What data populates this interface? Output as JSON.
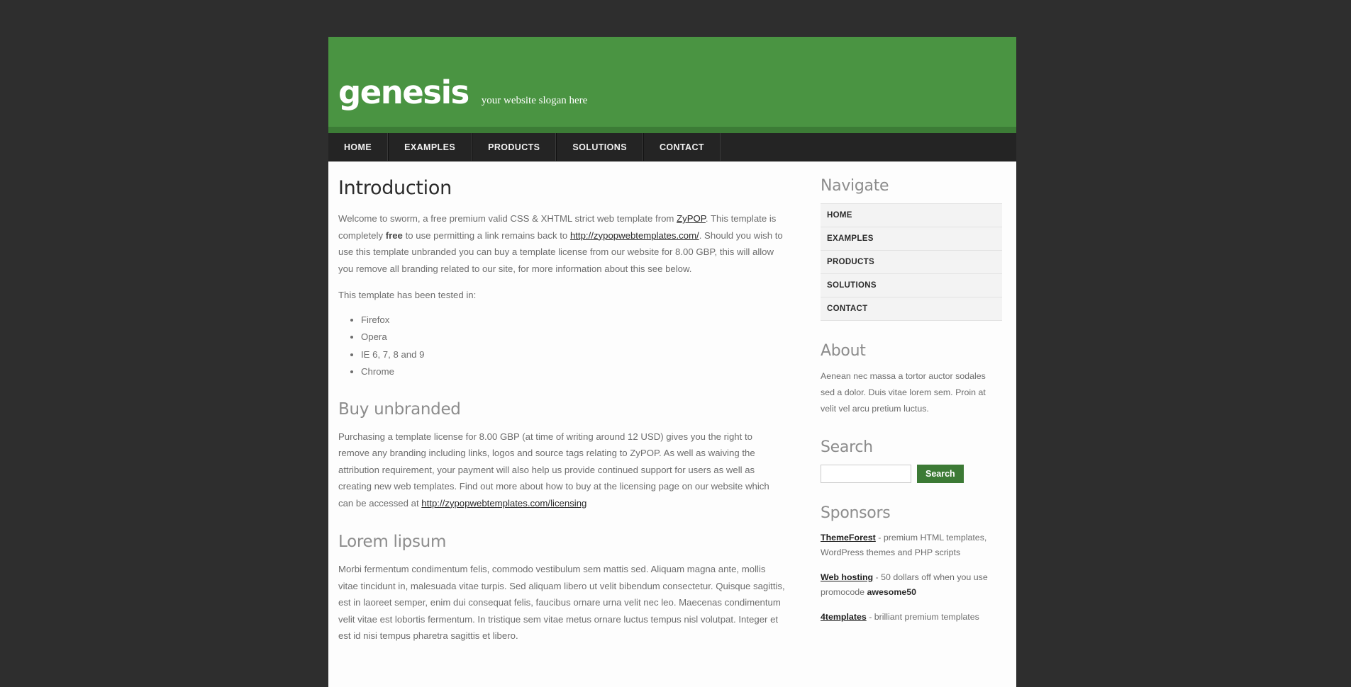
{
  "header": {
    "logo": "genesis",
    "slogan": "your website slogan here",
    "green": "#4a9442",
    "dark_green": "#3c7c36"
  },
  "main_nav": {
    "items": [
      {
        "label": "HOME"
      },
      {
        "label": "EXAMPLES"
      },
      {
        "label": "PRODUCTS"
      },
      {
        "label": "SOLUTIONS"
      },
      {
        "label": "CONTACT"
      }
    ]
  },
  "main": {
    "intro": {
      "title": "Introduction",
      "p1_a": "Welcome to sworm, a free premium valid CSS & XHTML strict web template from ",
      "p1_link1": "ZyPOP",
      "p1_b": ". This template is completely ",
      "p1_bold": "free",
      "p1_c": " to use permitting a link remains back to ",
      "p1_link2": "http://zypopwebtemplates.com/",
      "p1_d": ". Should you wish to use this template unbranded you can buy a template license from our website for 8.00 GBP, this will allow you remove all branding related to our site, for more information about this see below.",
      "tested_label": "This template has been tested in:",
      "browsers": [
        "Firefox",
        "Opera",
        "IE 6, 7, 8 and 9",
        "Chrome"
      ]
    },
    "buy": {
      "title": "Buy unbranded",
      "p_a": "Purchasing a template license for 8.00 GBP (at time of writing around 12 USD) gives you the right to remove any branding including links, logos and source tags relating to ZyPOP. As well as waiving the attribution requirement, your payment will also help us provide continued support for users as well as creating new web templates. Find out more about how to buy at the licensing page on our website which can be accessed at ",
      "p_link": "http://zypopwebtemplates.com/licensing"
    },
    "lorem": {
      "title": "Lorem lipsum",
      "p": "Morbi fermentum condimentum felis, commodo vestibulum sem mattis sed. Aliquam magna ante, mollis vitae tincidunt in, malesuada vitae turpis. Sed aliquam libero ut velit bibendum consectetur. Quisque sagittis, est in laoreet semper, enim dui consequat felis, faucibus ornare urna velit nec leo. Maecenas condimentum velit vitae est lobortis fermentum. In tristique sem vitae metus ornare luctus tempus nisl volutpat. Integer et est id nisi tempus pharetra sagittis et libero."
    }
  },
  "sidebar": {
    "navigate": {
      "title": "Navigate",
      "items": [
        {
          "label": "HOME"
        },
        {
          "label": "EXAMPLES"
        },
        {
          "label": "PRODUCTS"
        },
        {
          "label": "SOLUTIONS"
        },
        {
          "label": "CONTACT"
        }
      ]
    },
    "about": {
      "title": "About",
      "text": "Aenean nec massa a tortor auctor sodales sed a dolor. Duis vitae lorem sem. Proin at velit vel arcu pretium luctus."
    },
    "search": {
      "title": "Search",
      "value": "",
      "placeholder": "",
      "button_label": "Search",
      "button_color": "#3c7a35"
    },
    "sponsors": {
      "title": "Sponsors",
      "items": [
        {
          "link": "ThemeForest",
          "text": " - premium HTML templates, WordPress themes and PHP scripts",
          "bold": ""
        },
        {
          "link": "Web hosting",
          "text": " - 50 dollars off when you use promocode ",
          "bold": "awesome50"
        },
        {
          "link": "4templates",
          "text": " - brilliant premium templates",
          "bold": ""
        }
      ]
    }
  }
}
